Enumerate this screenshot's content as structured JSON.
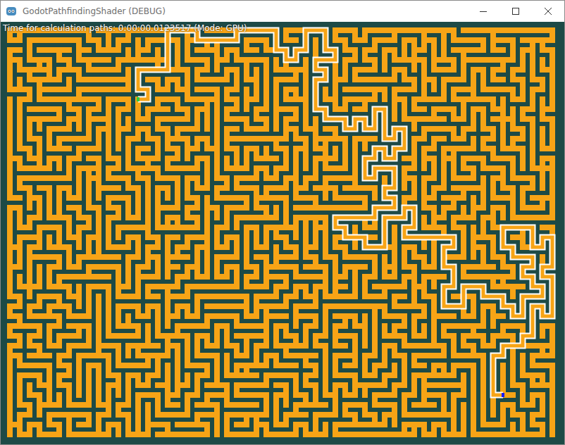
{
  "window": {
    "title": "GodotPathfindingShader (DEBUG)"
  },
  "overlay": {
    "text": "Time for calculation paths: 0:00:00.0123517 (Mode: GPU)"
  },
  "markers": [
    {
      "name": "start",
      "color": "#2ecc40"
    },
    {
      "name": "goal",
      "color": "#1a1aff"
    }
  ]
}
